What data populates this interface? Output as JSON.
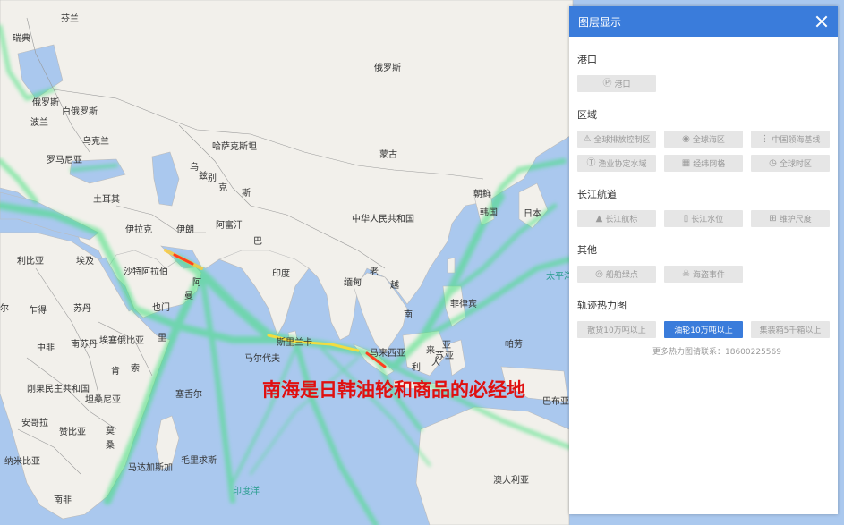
{
  "map": {
    "labels": {
      "finland": "芬兰",
      "sweden": "瑞典",
      "russia_w": "俄罗斯",
      "russia": "俄罗斯",
      "belarus": "白俄罗斯",
      "poland": "波兰",
      "ukraine": "乌克兰",
      "romania": "罗马尼亚",
      "turkey": "土耳其",
      "kazakhstan": "哈萨克斯坦",
      "mongolia": "蒙古",
      "uzbekistan": "乌",
      "turkmen1": "兹",
      "turkmen2": "别",
      "kyrgyz": "克",
      "tajik": "斯",
      "china": "中华人民共和国",
      "korea": "朝鲜",
      "south_korea": "韩国",
      "japan": "日本",
      "iraq": "伊拉克",
      "iran": "伊朗",
      "afghanistan": "阿富汗",
      "pakistan": "巴",
      "india": "印度",
      "myanmar": "缅甸",
      "laos": "老",
      "vietnam": "越",
      "cambodia": "南",
      "philippines": "菲律宾",
      "malaysia": "马来西亚",
      "libya": "利比亚",
      "egypt": "埃及",
      "saudi": "沙特阿拉伯",
      "oman": "阿",
      "oman2": "曼",
      "yemen": "也门",
      "chad": "乍得",
      "sudan": "苏丹",
      "south_sudan": "南苏丹",
      "ethiopia": "埃塞俄比亚",
      "somalia": "里",
      "somalia2": "索",
      "kenya": "肯",
      "niger": "尔",
      "central_af": "中非",
      "drc": "刚果民主共和国",
      "tanzania": "坦桑尼亚",
      "angola": "安哥拉",
      "zambia": "赞比亚",
      "namibia": "纳米比亚",
      "mozambique": "莫",
      "mozambique2": "桑",
      "madagascar": "马达加斯加",
      "south_africa": "南非",
      "seychelles": "塞舌尔",
      "maldives": "马尔代夫",
      "srilanka": "斯里兰卡",
      "mauritius": "毛里求斯",
      "australia": "澳大利亚",
      "papua": "帕劳",
      "indonesia1": "亚",
      "indonesia2": "来",
      "png": "巴布亚",
      "bu1": "大",
      "bu2": "利",
      "tu1": "苏",
      "tu2": "亚",
      "pacific": "太平洋",
      "indian_ocean": "印度洋"
    },
    "annotation": "南海是日韩油轮和商品的必经地"
  },
  "panel": {
    "title": "图层显示",
    "sections": [
      {
        "title": "港口",
        "buttons": [
          {
            "label": "港口",
            "icon": "Ⓟ",
            "active": false
          }
        ]
      },
      {
        "title": "区域",
        "buttons": [
          {
            "label": "全球排放控制区",
            "icon": "⚠",
            "active": false
          },
          {
            "label": "全球海区",
            "icon": "◉",
            "active": false
          },
          {
            "label": "中国领海基线",
            "icon": "⋮",
            "active": false
          },
          {
            "label": "渔业协定水域",
            "icon": "Ⓣ",
            "active": false
          },
          {
            "label": "经纬网格",
            "icon": "▦",
            "active": false
          },
          {
            "label": "全球时区",
            "icon": "◷",
            "active": false
          }
        ]
      },
      {
        "title": "长江航道",
        "buttons": [
          {
            "label": "长江航标",
            "icon": "▲",
            "active": false
          },
          {
            "label": "长江水位",
            "icon": "▯",
            "active": false
          },
          {
            "label": "维护尺度",
            "icon": "⊞",
            "active": false
          }
        ]
      },
      {
        "title": "其他",
        "buttons": [
          {
            "label": "船舶绿点",
            "icon": "◎",
            "active": false
          },
          {
            "label": "海盗事件",
            "icon": "☠",
            "active": false
          }
        ]
      },
      {
        "title": "轨迹热力图",
        "buttons": [
          {
            "label": "散货10万吨以上",
            "icon": "",
            "active": false
          },
          {
            "label": "油轮10万吨以上",
            "icon": "",
            "active": true
          },
          {
            "label": "集装箱5千箱以上",
            "icon": "",
            "active": false
          }
        ]
      }
    ],
    "contact": "更多热力图请联系：18600225569"
  },
  "colors": {
    "header": "#3a7cdb",
    "land": "#f2f0eb",
    "ocean": "#aac8ee",
    "heat": "#3fe07a",
    "hot": "#ff4020"
  }
}
